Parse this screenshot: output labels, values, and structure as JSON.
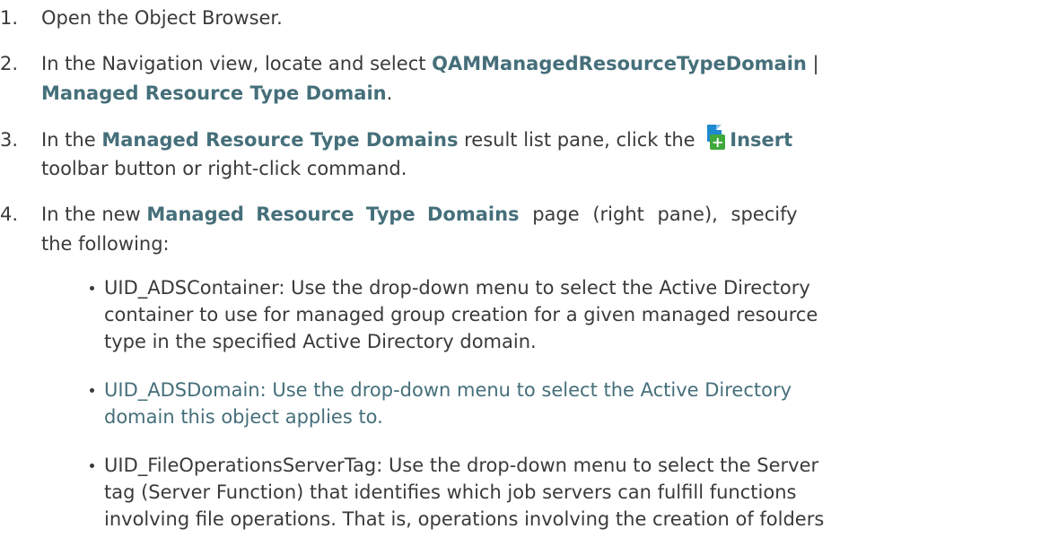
{
  "steps": [
    {
      "num": "1.",
      "text": "Open the Object Browser."
    },
    {
      "num": "2.",
      "pre": "In the Navigation view, locate and select ",
      "bold1": "QAMManagedResourceTypeDomain",
      "sep": " |",
      "bold2": "Managed Resource Type Domain",
      "post": "."
    },
    {
      "num": "3.",
      "pre": "In the ",
      "bold1": "Managed Resource Type Domains",
      "mid": " result list pane, click the ",
      "bold2": "Insert",
      "post": "toolbar button or right-click command."
    },
    {
      "num": "4.",
      "pre": "In the new ",
      "bold1": "Managed Resource Type Domains",
      "mid": " page (right pane), specify",
      "post": "the  following:"
    }
  ],
  "bullets": [
    {
      "lines": [
        "UID_ADSContainer: Use the drop-down menu to select the Active Directory",
        "container to use for managed group creation for a given managed resource",
        "type in the specified Active Directory domain."
      ]
    },
    {
      "lines": [
        "UID_ADSDomain: Use the drop-down menu to select the Active Directory",
        "domain this object applies to."
      ]
    },
    {
      "lines": [
        "UID_FileOperationsServerTag: Use the drop-down menu to select the Server",
        "tag (Server Function) that identifies which job servers can fulfill functions",
        "involving file operations. That is, operations involving the creation of folders"
      ]
    }
  ],
  "icons": {
    "insert": "insert-icon",
    "bullet": "bullet-dot"
  },
  "colors": {
    "text": "#3a3a3a",
    "emphasis": "#456f7a",
    "icon_blue": "#1e88d0",
    "icon_green": "#3fa93b"
  }
}
